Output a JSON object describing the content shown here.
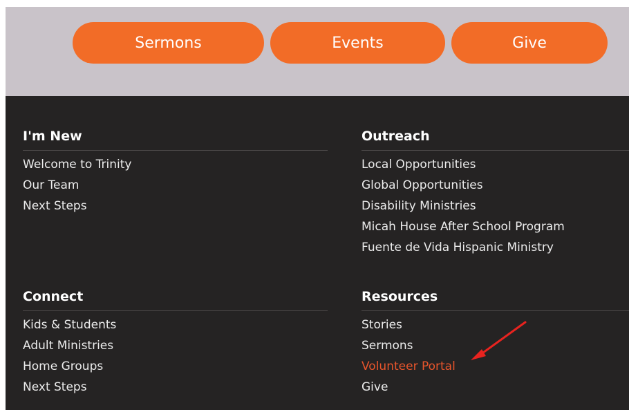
{
  "top_nav": {
    "buttons": [
      "Sermons",
      "Events",
      "Give"
    ]
  },
  "footer": {
    "im_new": {
      "heading": "I'm New",
      "links": [
        "Welcome to Trinity",
        "Our Team",
        "Next Steps"
      ]
    },
    "outreach": {
      "heading": "Outreach",
      "links": [
        "Local Opportunities",
        "Global Opportunities",
        "Disability Ministries",
        "Micah House After School Program",
        "Fuente de Vida Hispanic Ministry"
      ]
    },
    "connect": {
      "heading": "Connect",
      "links": [
        "Kids & Students",
        "Adult Ministries",
        "Home Groups",
        "Next Steps"
      ]
    },
    "resources": {
      "heading": "Resources",
      "links": [
        "Stories",
        "Sermons",
        "Volunteer Portal",
        "Give"
      ]
    }
  },
  "colors": {
    "accent": "#f26c27",
    "highlight_link": "#e8552c",
    "annotation_arrow": "#e8231f",
    "footer_bg": "#252323",
    "top_band_bg": "#c9c3c9"
  }
}
